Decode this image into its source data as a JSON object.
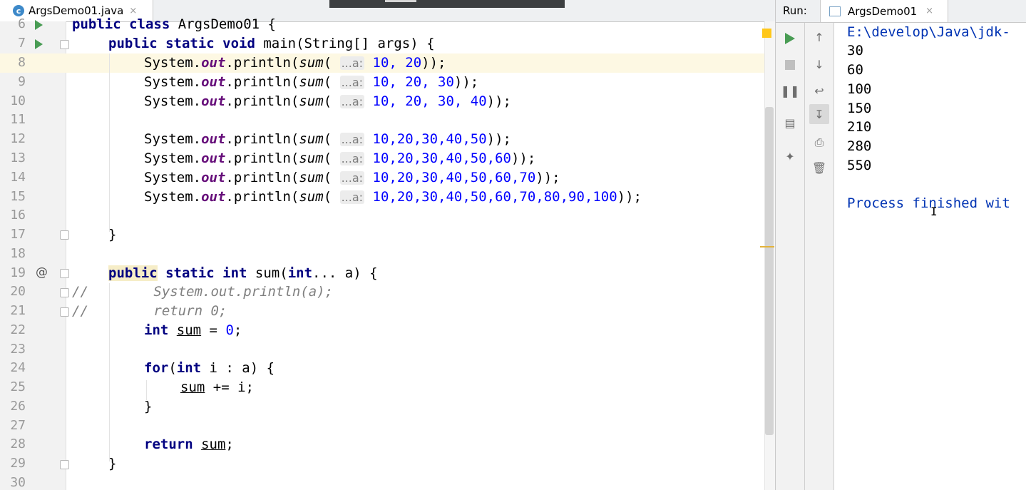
{
  "editor": {
    "tab": {
      "icon": "java-class-icon",
      "label": "ArgsDemo01.java",
      "close": "×"
    },
    "lines": [
      {
        "n": "6",
        "y": 22
      },
      {
        "n": "7"
      },
      {
        "n": "8"
      },
      {
        "n": "9"
      },
      {
        "n": "10"
      },
      {
        "n": "11"
      },
      {
        "n": "12"
      },
      {
        "n": "13"
      },
      {
        "n": "14"
      },
      {
        "n": "15"
      },
      {
        "n": "16"
      },
      {
        "n": "17"
      },
      {
        "n": "18"
      },
      {
        "n": "19"
      },
      {
        "n": "20"
      },
      {
        "n": "21"
      },
      {
        "n": "22"
      },
      {
        "n": "23"
      },
      {
        "n": "24"
      },
      {
        "n": "25"
      },
      {
        "n": "26"
      },
      {
        "n": "27"
      },
      {
        "n": "28"
      },
      {
        "n": "29"
      },
      {
        "n": "30"
      }
    ],
    "code": {
      "l6_a": "public class ",
      "l6_b": "ArgsDemo01 {",
      "l7_kw": "public static void",
      "l7_rest": " main(String[] args) {",
      "sys": "System.",
      "out": "out",
      "println": ".println(",
      "sum": "sum",
      "paren": "(",
      "hint": "...a:",
      "l8_args": "10, 20",
      "l9_args": "10, 20, 30",
      "l10_args": "10, 20, 30, 40",
      "l12_args": "10,20,30,40,50",
      "l13_args": "10,20,30,40,50,60",
      "l14_args": "10,20,30,40,50,60,70",
      "l15_args": "10,20,30,40,50,60,70,80,90,100",
      "close2": "));",
      "brace_close": "}",
      "at": "@",
      "l19_pub": "public",
      "l19_kw": " static int",
      "l19_mid": " sum(",
      "l19_int": "int",
      "l19_end": "... a) {",
      "l20": "//        System.out.println(a);",
      "l21": "//        return 0;",
      "int": "int",
      "l22_sum": "sum",
      "l22_rest": " = ",
      "l22_zero": "0",
      "semi": ";",
      "l24_for": "for",
      "l24_mid": "(",
      "l24_int": "int",
      "l24_rest": " i : a) {",
      "l25_sum": "sum",
      "l25_rest": " += i;",
      "l28_ret": "return",
      "l28_sum": "sum"
    }
  },
  "run": {
    "label": "Run:",
    "tab": {
      "label": "ArgsDemo01",
      "close": "×"
    },
    "console": [
      "E:\\develop\\Java\\jdk-",
      "30",
      "60",
      "100",
      "150",
      "210",
      "280",
      "550",
      "",
      "Process finished wit"
    ],
    "toolbar_left": [
      "run-icon",
      "stop-icon",
      "pause-icon",
      "layout-icon",
      "pin-icon"
    ],
    "toolbar_right": [
      "up-arrow-icon",
      "down-arrow-icon",
      "soft-wrap-icon",
      "scroll-to-end-icon",
      "print-icon",
      "trash-icon"
    ]
  },
  "colors": {
    "keyword": "#000080",
    "number": "#0000ff",
    "field": "#660e7a",
    "comment": "#808080",
    "run_green": "#499c54"
  }
}
